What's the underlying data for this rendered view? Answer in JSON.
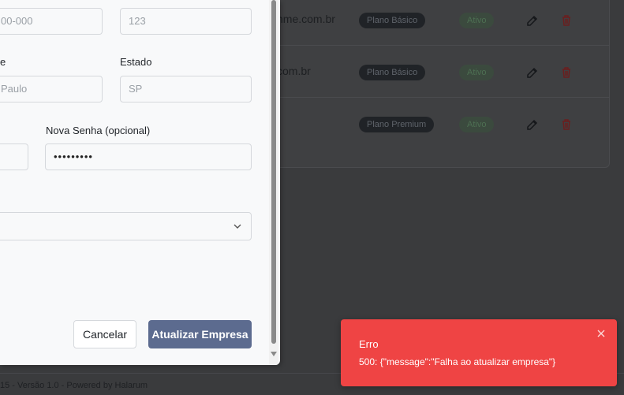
{
  "background": {
    "rows": [
      {
        "email": "nme.com.br",
        "plan": "Plano Básico",
        "status": "Ativo"
      },
      {
        "email": "com.br",
        "plan": "Plano Básico",
        "status": "Ativo"
      },
      {
        "email": "",
        "plan": "Plano Premium",
        "status": "Ativo"
      }
    ],
    "footer": "15 - Versão 1.0 - Powered by Halarum"
  },
  "modal": {
    "cep_value": "00-000",
    "numero_value": "123",
    "cidade_label": "e",
    "cidade_value": "Paulo",
    "estado_label": "Estado",
    "estado_value": "SP",
    "nova_senha_label": "Nova Senha (opcional)",
    "nova_senha_value": "•••••••••",
    "select_value": "",
    "cancel_label": "Cancelar",
    "update_label": "Atualizar Empresa"
  },
  "toast": {
    "title": "Erro",
    "message": "500: {\"message\":\"Falha ao atualizar empresa\"}"
  },
  "colors": {
    "toast_bg": "#ef4444",
    "primary_button": "#5c6b8f",
    "overlay": "#3a3b3d"
  },
  "icons": {
    "edit": "edit-icon",
    "delete": "trash-icon",
    "close": "close-icon",
    "chevron": "chevron-down-icon"
  }
}
